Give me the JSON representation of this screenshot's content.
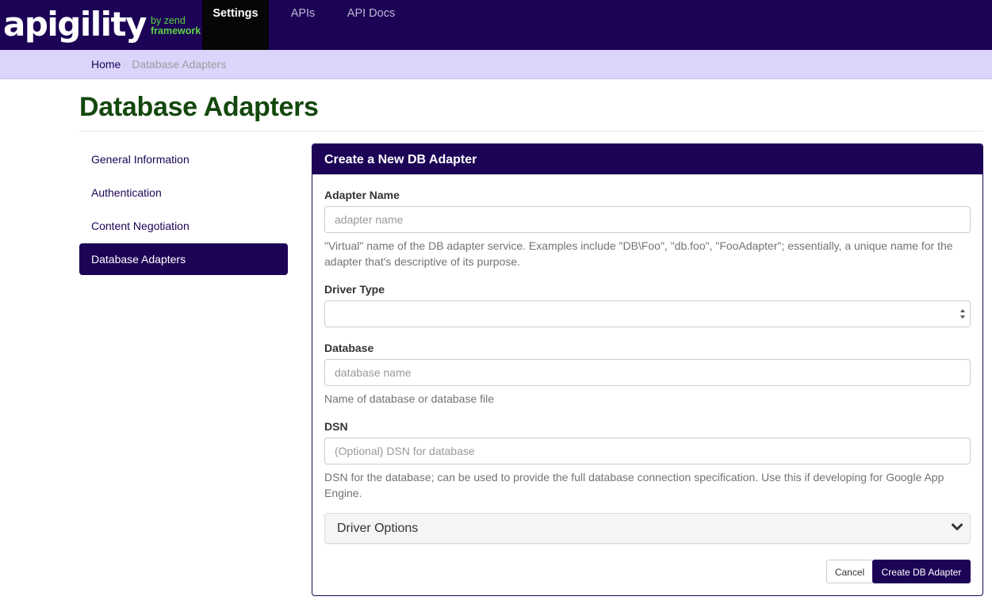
{
  "navbar": {
    "brand_name": "apigility",
    "brand_by": "by zend",
    "brand_framework": "framework",
    "tabs": [
      {
        "label": "Settings",
        "active": true
      },
      {
        "label": "APIs",
        "active": false
      },
      {
        "label": "API Docs",
        "active": false
      }
    ]
  },
  "breadcrumb": {
    "home": "Home",
    "separator": "/",
    "current": "Database Adapters"
  },
  "page": {
    "title": "Database Adapters"
  },
  "sidebar": {
    "items": [
      {
        "label": "General Information",
        "active": false
      },
      {
        "label": "Authentication",
        "active": false
      },
      {
        "label": "Content Negotiation",
        "active": false
      },
      {
        "label": "Database Adapters",
        "active": true
      }
    ]
  },
  "form": {
    "heading": "Create a New DB Adapter",
    "adapter_name": {
      "label": "Adapter Name",
      "value": "",
      "placeholder": "adapter name",
      "help": "\"Virtual\" name of the DB adapter service. Examples include \"DB\\Foo\", \"db.foo\", \"FooAdapter\"; essentially, a unique name for the adapter that's descriptive of its purpose."
    },
    "driver_type": {
      "label": "Driver Type",
      "selected": ""
    },
    "database": {
      "label": "Database",
      "value": "",
      "placeholder": "database name",
      "help": "Name of database or database file"
    },
    "dsn": {
      "label": "DSN",
      "value": "",
      "placeholder": "(Optional) DSN for database",
      "help": "DSN for the database; can be used to provide the full database connection specification. Use this if developing for Google App Engine."
    },
    "driver_options": {
      "label": "Driver Options",
      "icon": "chevron-down-icon"
    },
    "cancel_label": "Cancel",
    "create_label": "Create DB Adapter"
  },
  "colors": {
    "brand_purple": "#1c0356",
    "brand_green": "#5fd143",
    "title_green": "#14480e",
    "breadcrumb_bg": "#dbd5fc"
  }
}
